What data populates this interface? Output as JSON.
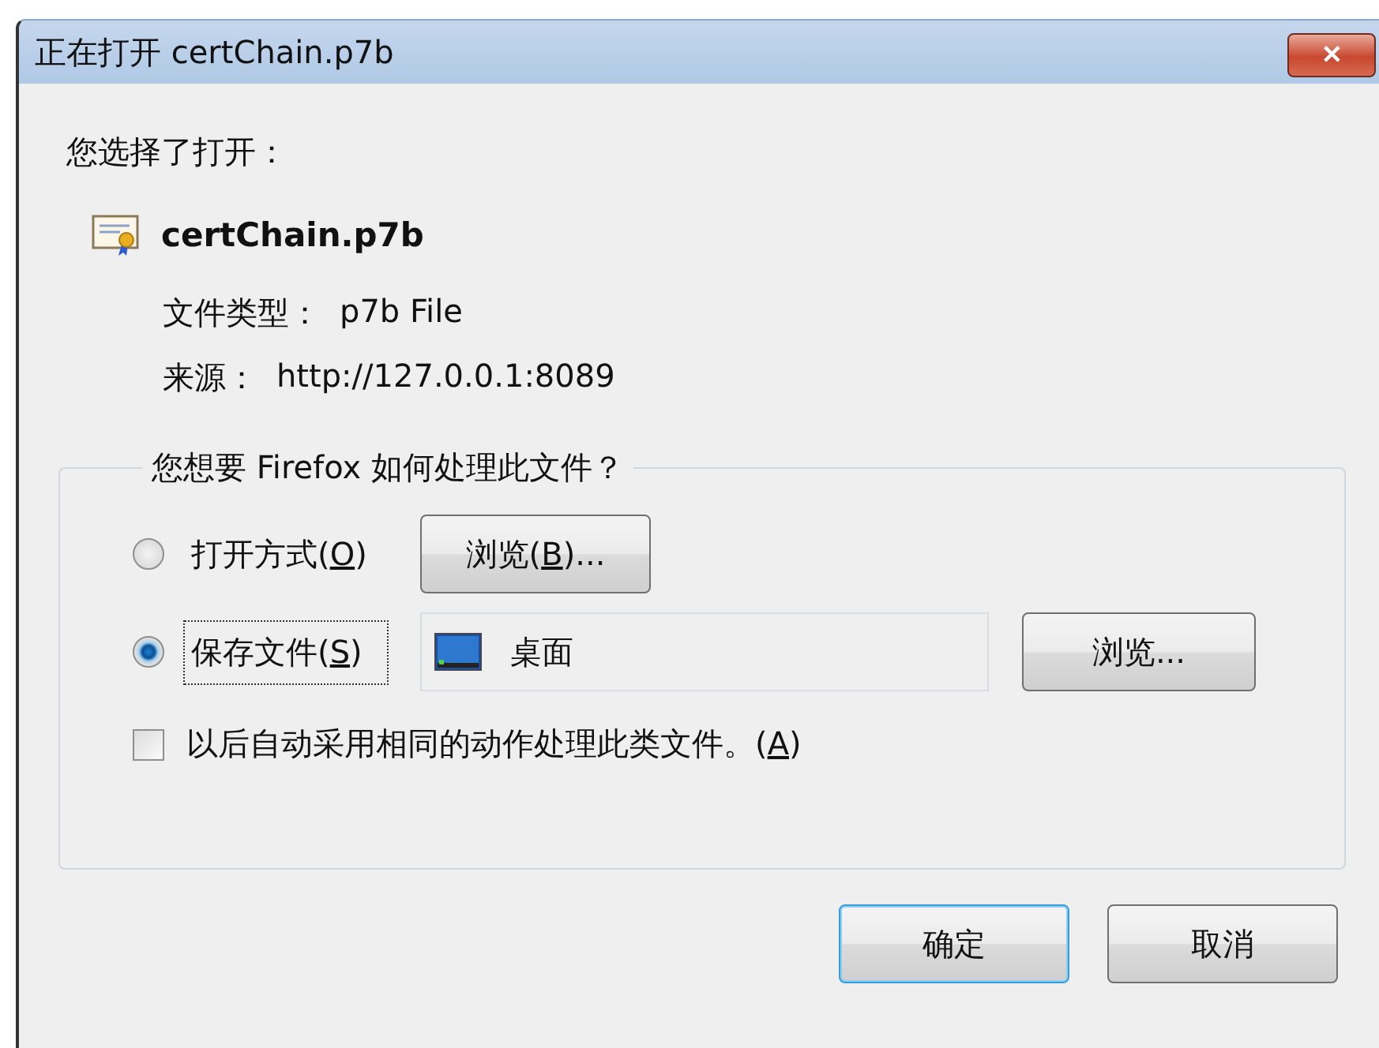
{
  "window": {
    "title": "正在打开 certChain.p7b",
    "close_label": "✕"
  },
  "intro": "您选择了打开：",
  "file": {
    "name": "certChain.p7b",
    "type_label": "文件类型：",
    "type_value": "p7b File",
    "source_label": "来源：",
    "source_value": "http://127.0.0.1:8089"
  },
  "action_group": {
    "legend": "您想要 Firefox 如何处理此文件？",
    "options": [
      {
        "kind": "open",
        "label_before": "打开方式(",
        "access_key": "O",
        "label_after": ")",
        "selected": false,
        "focused": false,
        "button": {
          "label_before": "浏览(",
          "access_key": "B",
          "label_after": ")..."
        }
      },
      {
        "kind": "save",
        "label_before": "保存文件(",
        "access_key": "S",
        "label_after": ")",
        "selected": true,
        "focused": true,
        "folder": "桌面",
        "button": {
          "label_before": "浏览..."
        }
      }
    ],
    "remember": {
      "label_before": "以后自动采用相同的动作处理此类文件。(",
      "access_key": "A",
      "label_after": ")",
      "checked": false
    }
  },
  "buttons": [
    {
      "label": "确定",
      "default": true
    },
    {
      "label": "取消",
      "default": false
    }
  ]
}
